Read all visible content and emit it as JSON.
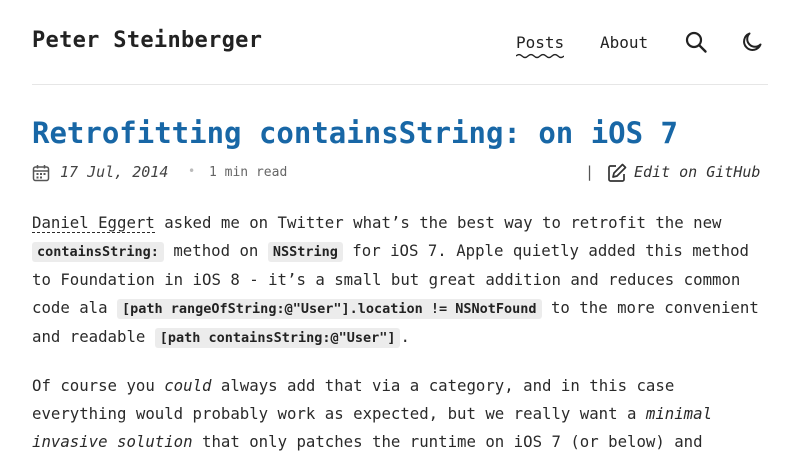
{
  "site": {
    "title": "Peter Steinberger"
  },
  "nav": {
    "posts": "Posts",
    "about": "About"
  },
  "post": {
    "title": "Retrofitting containsString: on iOS 7",
    "date": "17 Jul, 2014",
    "separator": "•",
    "read_time": "1 min read",
    "pipe": "|",
    "edit_label": "Edit on GitHub"
  },
  "body": {
    "p1": {
      "link": "Daniel Eggert",
      "t1": " asked me on Twitter what’s the best way to retrofit the new ",
      "c1": "containsString:",
      "t2": " method on ",
      "c2": "NSString",
      "t3": " for iOS 7. Apple quietly added this method to Foundation in iOS 8 - it’s a small but great addition and reduces common code ala ",
      "c3": "[path rangeOfString:@\"User\"].location != NSNotFound",
      "t4": " to the more convenient and readable ",
      "c4": "[path containsString:@\"User\"]",
      "t5": "."
    },
    "p2": {
      "t1": "Of course you ",
      "em1": "could",
      "t2": " always add that via a category, and in this case everything would probably work as expected, but we really want a ",
      "em2": "minimal invasive solution",
      "t3": " that only patches the runtime on iOS 7 (or below) and"
    }
  }
}
